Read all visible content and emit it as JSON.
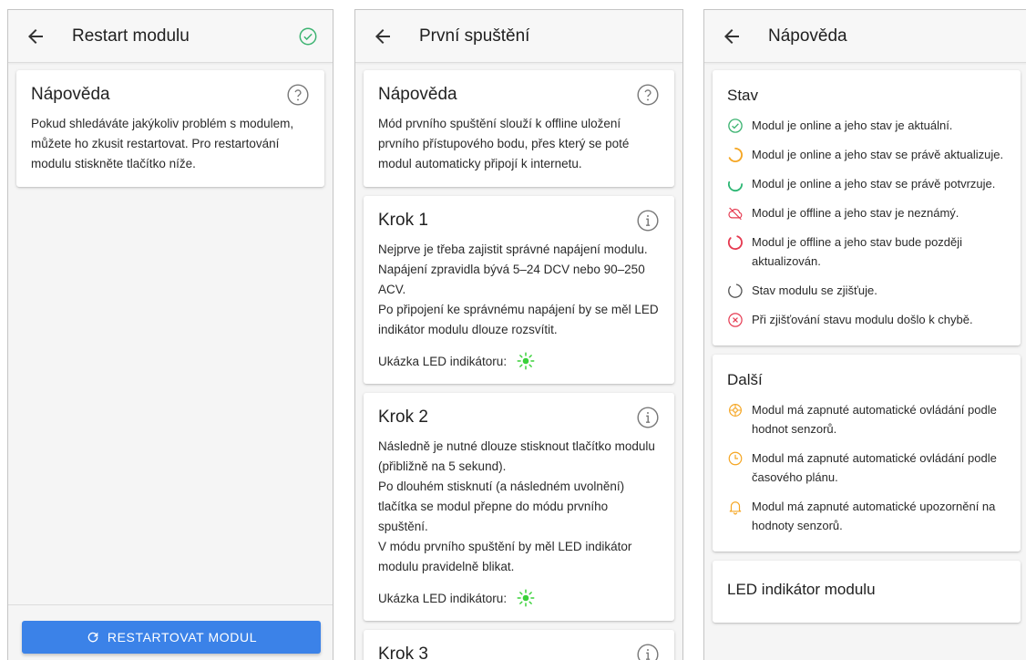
{
  "screens": [
    {
      "title": "Restart modulu",
      "status_icon": "check-circle-icon",
      "help_card": {
        "title": "Nápověda",
        "text": "Pokud shledáváte jakýkoliv problém s modulem, můžete ho zkusit restartovat. Pro restartování modulu stiskněte tlačítko níže."
      },
      "button_label": "RESTARTOVAT MODUL"
    },
    {
      "title": "První spuštění",
      "help_card": {
        "title": "Nápověda",
        "text": "Mód prvního spuštění slouží k offline uložení prvního přístupového bodu, přes který se poté modul automaticky připojí k internetu."
      },
      "steps": [
        {
          "title": "Krok 1",
          "lines": [
            "Nejprve je třeba zajistit správné napájení modulu. Napájení zpravidla bývá 5–24 DCV nebo 90–250 ACV.",
            "Po připojení ke správnému napájení by se měl LED indikátor modulu dlouze rozsvítit."
          ],
          "led_label": "Ukázka LED indikátoru:"
        },
        {
          "title": "Krok 2",
          "lines": [
            "Následně je nutné dlouze stisknout tlačítko modulu (přibližně na 5 sekund).",
            "Po dlouhém stisknutí (a následném uvolnění) tlačítka se modul přepne do módu prvního spuštění.",
            "V módu prvního spuštění by měl LED indikátor modulu pravidelně blikat."
          ],
          "led_label": "Ukázka LED indikátoru:"
        },
        {
          "title": "Krok 3"
        }
      ]
    },
    {
      "title": "Nápověda",
      "sections": [
        {
          "title": "Stav",
          "items": [
            {
              "icon": "check-circle-icon",
              "text": "Modul je online a jeho stav je aktuální."
            },
            {
              "icon": "spinner-orange-icon",
              "text": "Modul je online a jeho stav se právě aktualizuje."
            },
            {
              "icon": "spinner-green-icon",
              "text": "Modul je online a jeho stav se právě potvrzuje."
            },
            {
              "icon": "cloud-off-icon",
              "text": "Modul je offline a jeho stav je neznámý."
            },
            {
              "icon": "spinner-red-icon",
              "text": "Modul je offline a jeho stav bude později aktualizován."
            },
            {
              "icon": "spinner-grey-icon",
              "text": "Stav modulu se zjišťuje."
            },
            {
              "icon": "error-circle-icon",
              "text": "Při zjišťování stavu modulu došlo k chybě."
            }
          ]
        },
        {
          "title": "Další",
          "items": [
            {
              "icon": "sensor-auto-icon",
              "text": "Modul má zapnuté automatické ovládání podle hodnot senzorů."
            },
            {
              "icon": "clock-icon",
              "text": "Modul má zapnuté automatické ovládání podle časového plánu."
            },
            {
              "icon": "bell-icon",
              "text": "Modul má zapnuté automatické upozornění na hodnoty senzorů."
            }
          ]
        },
        {
          "title": "LED indikátor modulu",
          "items": []
        }
      ]
    }
  ],
  "colors": {
    "accent": "#3b82e8",
    "online": "#3cb371",
    "updating": "#f5a623",
    "confirming": "#2bb673",
    "offline": "#e53950",
    "error": "#e53950",
    "led": "#3ad13a"
  }
}
